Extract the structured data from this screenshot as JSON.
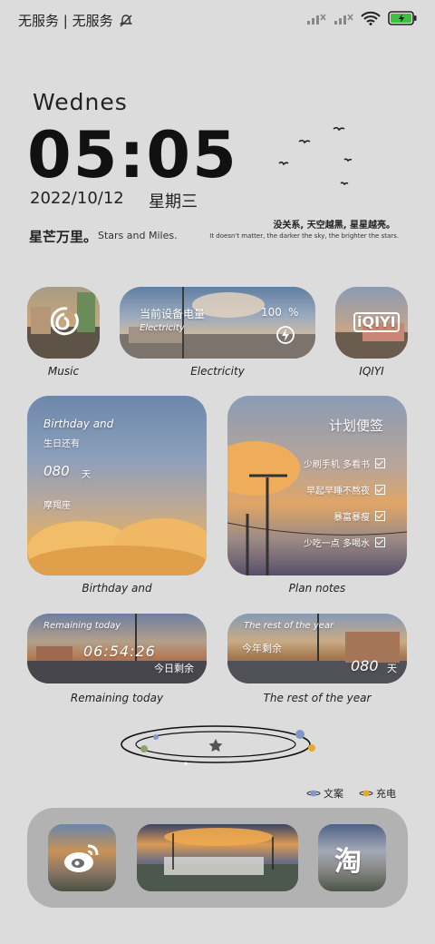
{
  "status_bar": {
    "carrier": "无服务 | 无服务",
    "icons": [
      "mute-bell-icon",
      "signal-icon",
      "signal-icon",
      "wifi-icon",
      "battery-charging-icon"
    ],
    "battery_color": "#3fbf3f"
  },
  "clock": {
    "day_name": "Wednes",
    "time": "05:05",
    "date": "2022/10/12",
    "weekday": "星期三"
  },
  "motto": {
    "cn": "星芒万里。",
    "en": "Stars and Miles."
  },
  "quote": {
    "cn": "没关系, 天空越黑, 星星越亮。",
    "en": "It doesn't matter, the darker the sky, the brighter the stars."
  },
  "widgets": {
    "music": {
      "label": "Music",
      "icon": "netease-music-icon"
    },
    "electricity": {
      "label": "Electricity",
      "title": "当前设备电量",
      "subtitle": "Electricity",
      "value": "100",
      "unit": "%",
      "icon": "lightning-icon"
    },
    "iqiyi": {
      "label": "IQIYI",
      "logo": "iQIYI"
    },
    "birthday": {
      "label": "Birthday and",
      "title": "Birthday and",
      "subtitle": "生日还有",
      "days": "080",
      "unit": "天",
      "sign": "摩羯座"
    },
    "plan": {
      "label": "Plan notes",
      "title": "计划便签",
      "items": [
        {
          "text": "少刷手机 多看书",
          "checked": true
        },
        {
          "text": "早起早睡不熬夜",
          "checked": true
        },
        {
          "text": "暴富暴瘦",
          "checked": true
        },
        {
          "text": "少吃一点 多喝水",
          "checked": true
        }
      ]
    },
    "remaining_today": {
      "label": "Remaining today",
      "title": "Remaining today",
      "time": "06:54:26",
      "caption": "今日剩余"
    },
    "rest_of_year": {
      "label": "The rest of the year",
      "title": "The rest of the year",
      "caption": "今年剩余",
      "days": "080",
      "unit": "天"
    }
  },
  "orbit_legend": [
    {
      "text": "文案",
      "color": "#7f97c9"
    },
    {
      "text": "充电",
      "color": "#e7a92a"
    }
  ],
  "dock": {
    "apps": [
      {
        "name": "weibo",
        "icon": "weibo-icon"
      },
      {
        "name": "photo",
        "icon": "photo-icon"
      },
      {
        "name": "taobao",
        "glyph": "淘"
      }
    ]
  }
}
